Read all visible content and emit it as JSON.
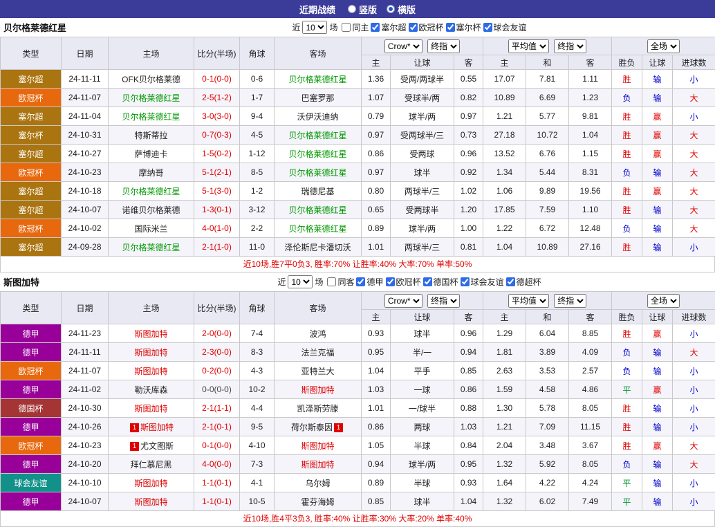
{
  "topbar": {
    "title": "近期战绩",
    "options": [
      {
        "label": "竖版",
        "checked": false
      },
      {
        "label": "横版",
        "checked": true
      }
    ]
  },
  "filter": {
    "near": "近",
    "count": "10",
    "games": "场"
  },
  "table_header": {
    "type": "类型",
    "date": "日期",
    "home": "主场",
    "score": "比分(半场)",
    "corner": "角球",
    "away": "客场",
    "provider": "Crow*",
    "stage": "终指",
    "avg": "平均值",
    "stage2": "终指",
    "scope": "全场",
    "sub": {
      "h": "主",
      "hcp": "让球",
      "a": "客",
      "avg_h": "主",
      "avg_d": "和",
      "avg_a": "客",
      "wdl": "胜负",
      "hcp_r": "让球",
      "goal": "进球数"
    }
  },
  "league_colors": {
    "塞尔超": "#aa7410",
    "欧冠杯": "#e8680e",
    "塞尔杯": "#aa7410",
    "德甲": "#990099",
    "德国杯": "#a53535",
    "球会友谊": "#12918a"
  },
  "result_colors": {
    "胜": "#e00000",
    "平": "#009933",
    "负": "#0000cc",
    "赢": "#e00000",
    "输": "#0000cc",
    "大": "#e00000",
    "小": "#0000cc"
  },
  "sections": [
    {
      "team": "贝尔格莱德红星",
      "team_color": "#009900",
      "filters": [
        {
          "label": "同主",
          "checked": false
        },
        {
          "label": "塞尔超",
          "checked": true
        },
        {
          "label": "欧冠杯",
          "checked": true
        },
        {
          "label": "塞尔杯",
          "checked": true
        },
        {
          "label": "球会友谊",
          "checked": true
        }
      ],
      "rows": [
        {
          "league": "塞尔超",
          "date": "24-11-11",
          "home": {
            "text": "OFK贝尔格莱德"
          },
          "score": "0-1(0-0)",
          "corner": "0-6",
          "away": {
            "text": "贝尔格莱德红星",
            "hl": true
          },
          "odds": [
            "1.36",
            "受两/两球半",
            "0.55"
          ],
          "avg": [
            "17.07",
            "7.81",
            "1.11"
          ],
          "results": [
            "胜",
            "输",
            "小"
          ]
        },
        {
          "league": "欧冠杯",
          "date": "24-11-07",
          "home": {
            "text": "贝尔格莱德红星",
            "hl": true
          },
          "score": "2-5(1-2)",
          "corner": "1-7",
          "away": {
            "text": "巴塞罗那"
          },
          "odds": [
            "1.07",
            "受球半/两",
            "0.82"
          ],
          "avg": [
            "10.89",
            "6.69",
            "1.23"
          ],
          "results": [
            "负",
            "输",
            "大"
          ]
        },
        {
          "league": "塞尔超",
          "date": "24-11-04",
          "home": {
            "text": "贝尔格莱德红星",
            "hl": true
          },
          "score": "3-0(3-0)",
          "corner": "9-4",
          "away": {
            "text": "沃伊沃迪纳"
          },
          "odds": [
            "0.79",
            "球半/两",
            "0.97"
          ],
          "avg": [
            "1.21",
            "5.77",
            "9.81"
          ],
          "results": [
            "胜",
            "赢",
            "小"
          ]
        },
        {
          "league": "塞尔杯",
          "date": "24-10-31",
          "home": {
            "text": "特斯蒂拉"
          },
          "score": "0-7(0-3)",
          "corner": "4-5",
          "away": {
            "text": "贝尔格莱德红星",
            "hl": true
          },
          "odds": [
            "0.97",
            "受两球半/三",
            "0.73"
          ],
          "avg": [
            "27.18",
            "10.72",
            "1.04"
          ],
          "results": [
            "胜",
            "赢",
            "大"
          ]
        },
        {
          "league": "塞尔超",
          "date": "24-10-27",
          "home": {
            "text": "萨博迪卡"
          },
          "score": "1-5(0-2)",
          "corner": "1-12",
          "away": {
            "text": "贝尔格莱德红星",
            "hl": true
          },
          "odds": [
            "0.86",
            "受两球",
            "0.96"
          ],
          "avg": [
            "13.52",
            "6.76",
            "1.15"
          ],
          "results": [
            "胜",
            "赢",
            "大"
          ]
        },
        {
          "league": "欧冠杯",
          "date": "24-10-23",
          "home": {
            "text": "摩纳哥"
          },
          "score": "5-1(2-1)",
          "corner": "8-5",
          "away": {
            "text": "贝尔格莱德红星",
            "hl": true
          },
          "odds": [
            "0.97",
            "球半",
            "0.92"
          ],
          "avg": [
            "1.34",
            "5.44",
            "8.31"
          ],
          "results": [
            "负",
            "输",
            "大"
          ]
        },
        {
          "league": "塞尔超",
          "date": "24-10-18",
          "home": {
            "text": "贝尔格莱德红星",
            "hl": true
          },
          "score": "5-1(3-0)",
          "corner": "1-2",
          "away": {
            "text": "瑞德尼基"
          },
          "odds": [
            "0.80",
            "两球半/三",
            "1.02"
          ],
          "avg": [
            "1.06",
            "9.89",
            "19.56"
          ],
          "results": [
            "胜",
            "赢",
            "大"
          ]
        },
        {
          "league": "塞尔超",
          "date": "24-10-07",
          "home": {
            "text": "诺维贝尔格莱德"
          },
          "score": "1-3(0-1)",
          "corner": "3-12",
          "away": {
            "text": "贝尔格莱德红星",
            "hl": true
          },
          "odds": [
            "0.65",
            "受两球半",
            "1.20"
          ],
          "avg": [
            "17.85",
            "7.59",
            "1.10"
          ],
          "results": [
            "胜",
            "输",
            "大"
          ]
        },
        {
          "league": "欧冠杯",
          "date": "24-10-02",
          "home": {
            "text": "国际米兰"
          },
          "score": "4-0(1-0)",
          "corner": "2-2",
          "away": {
            "text": "贝尔格莱德红星",
            "hl": true
          },
          "odds": [
            "0.89",
            "球半/两",
            "1.00"
          ],
          "avg": [
            "1.22",
            "6.72",
            "12.48"
          ],
          "results": [
            "负",
            "输",
            "大"
          ]
        },
        {
          "league": "塞尔超",
          "date": "24-09-28",
          "home": {
            "text": "贝尔格莱德红星",
            "hl": true
          },
          "score": "2-1(1-0)",
          "corner": "11-0",
          "away": {
            "text": "泽伦斯尼卡潘切沃"
          },
          "odds": [
            "1.01",
            "两球半/三",
            "0.81"
          ],
          "avg": [
            "1.04",
            "10.89",
            "27.16"
          ],
          "results": [
            "胜",
            "输",
            "小"
          ]
        }
      ],
      "summary": "近10场,胜7平0负3, 胜率:70% 让胜率:40% 大率:70% 单率:50%"
    },
    {
      "team": "斯图加特",
      "team_color": "#e00000",
      "filters": [
        {
          "label": "同客",
          "checked": false
        },
        {
          "label": "德甲",
          "checked": true
        },
        {
          "label": "欧冠杯",
          "checked": true
        },
        {
          "label": "德国杯",
          "checked": true
        },
        {
          "label": "球会友谊",
          "checked": true
        },
        {
          "label": "德超杯",
          "checked": true
        }
      ],
      "rows": [
        {
          "league": "德甲",
          "date": "24-11-23",
          "home": {
            "text": "斯图加特",
            "hl": true
          },
          "score": "2-0(0-0)",
          "corner": "7-4",
          "away": {
            "text": "波鸿"
          },
          "odds": [
            "0.93",
            "球半",
            "0.96"
          ],
          "avg": [
            "1.29",
            "6.04",
            "8.85"
          ],
          "results": [
            "胜",
            "赢",
            "小"
          ]
        },
        {
          "league": "德甲",
          "date": "24-11-11",
          "home": {
            "text": "斯图加特",
            "hl": true
          },
          "score": "2-3(0-0)",
          "corner": "8-3",
          "away": {
            "text": "法兰克福"
          },
          "odds": [
            "0.95",
            "半/一",
            "0.94"
          ],
          "avg": [
            "1.81",
            "3.89",
            "4.09"
          ],
          "results": [
            "负",
            "输",
            "大"
          ]
        },
        {
          "league": "欧冠杯",
          "date": "24-11-07",
          "home": {
            "text": "斯图加特",
            "hl": true
          },
          "score": "0-2(0-0)",
          "corner": "4-3",
          "away": {
            "text": "亚特兰大"
          },
          "odds": [
            "1.04",
            "平手",
            "0.85"
          ],
          "avg": [
            "2.63",
            "3.53",
            "2.57"
          ],
          "results": [
            "负",
            "输",
            "小"
          ]
        },
        {
          "league": "德甲",
          "date": "24-11-02",
          "home": {
            "text": "勒沃库森"
          },
          "score": "0-0(0-0)",
          "score_black": true,
          "corner": "10-2",
          "away": {
            "text": "斯图加特",
            "hl": true
          },
          "odds": [
            "1.03",
            "一球",
            "0.86"
          ],
          "avg": [
            "1.59",
            "4.58",
            "4.86"
          ],
          "results": [
            "平",
            "赢",
            "小"
          ]
        },
        {
          "league": "德国杯",
          "date": "24-10-30",
          "home": {
            "text": "斯图加特",
            "hl": true
          },
          "score": "2-1(1-1)",
          "corner": "4-4",
          "away": {
            "text": "凯泽斯劳滕"
          },
          "odds": [
            "1.01",
            "一/球半",
            "0.88"
          ],
          "avg": [
            "1.30",
            "5.78",
            "8.05"
          ],
          "results": [
            "胜",
            "输",
            "小"
          ]
        },
        {
          "league": "德甲",
          "date": "24-10-26",
          "home": {
            "text": "斯图加特",
            "hl": true,
            "badge": "1"
          },
          "score": "2-1(0-1)",
          "corner": "9-5",
          "away": {
            "text": "荷尔斯泰因",
            "badge": "1"
          },
          "odds": [
            "0.86",
            "两球",
            "1.03"
          ],
          "avg": [
            "1.21",
            "7.09",
            "11.15"
          ],
          "results": [
            "胜",
            "输",
            "小"
          ]
        },
        {
          "league": "欧冠杯",
          "date": "24-10-23",
          "home": {
            "text": "尤文图斯",
            "badge": "1"
          },
          "score": "0-1(0-0)",
          "corner": "4-10",
          "away": {
            "text": "斯图加特",
            "hl": true
          },
          "odds": [
            "1.05",
            "半球",
            "0.84"
          ],
          "avg": [
            "2.04",
            "3.48",
            "3.67"
          ],
          "results": [
            "胜",
            "赢",
            "大"
          ]
        },
        {
          "league": "德甲",
          "date": "24-10-20",
          "home": {
            "text": "拜仁慕尼黑"
          },
          "score": "4-0(0-0)",
          "corner": "7-3",
          "away": {
            "text": "斯图加特",
            "hl": true
          },
          "odds": [
            "0.94",
            "球半/两",
            "0.95"
          ],
          "avg": [
            "1.32",
            "5.92",
            "8.05"
          ],
          "results": [
            "负",
            "输",
            "大"
          ]
        },
        {
          "league": "球会友谊",
          "date": "24-10-10",
          "home": {
            "text": "斯图加特",
            "hl": true
          },
          "score": "1-1(0-1)",
          "corner": "4-1",
          "away": {
            "text": "乌尔姆"
          },
          "odds": [
            "0.89",
            "半球",
            "0.93"
          ],
          "avg": [
            "1.64",
            "4.22",
            "4.24"
          ],
          "results": [
            "平",
            "输",
            "小"
          ]
        },
        {
          "league": "德甲",
          "date": "24-10-07",
          "home": {
            "text": "斯图加特",
            "hl": true
          },
          "score": "1-1(0-1)",
          "corner": "10-5",
          "away": {
            "text": "霍芬海姆"
          },
          "odds": [
            "0.85",
            "球半",
            "1.04"
          ],
          "avg": [
            "1.32",
            "6.02",
            "7.49"
          ],
          "results": [
            "平",
            "输",
            "小"
          ]
        }
      ],
      "summary": "近10场,胜4平3负3, 胜率:40% 让胜率:30% 大率:20% 单率:40%"
    }
  ]
}
